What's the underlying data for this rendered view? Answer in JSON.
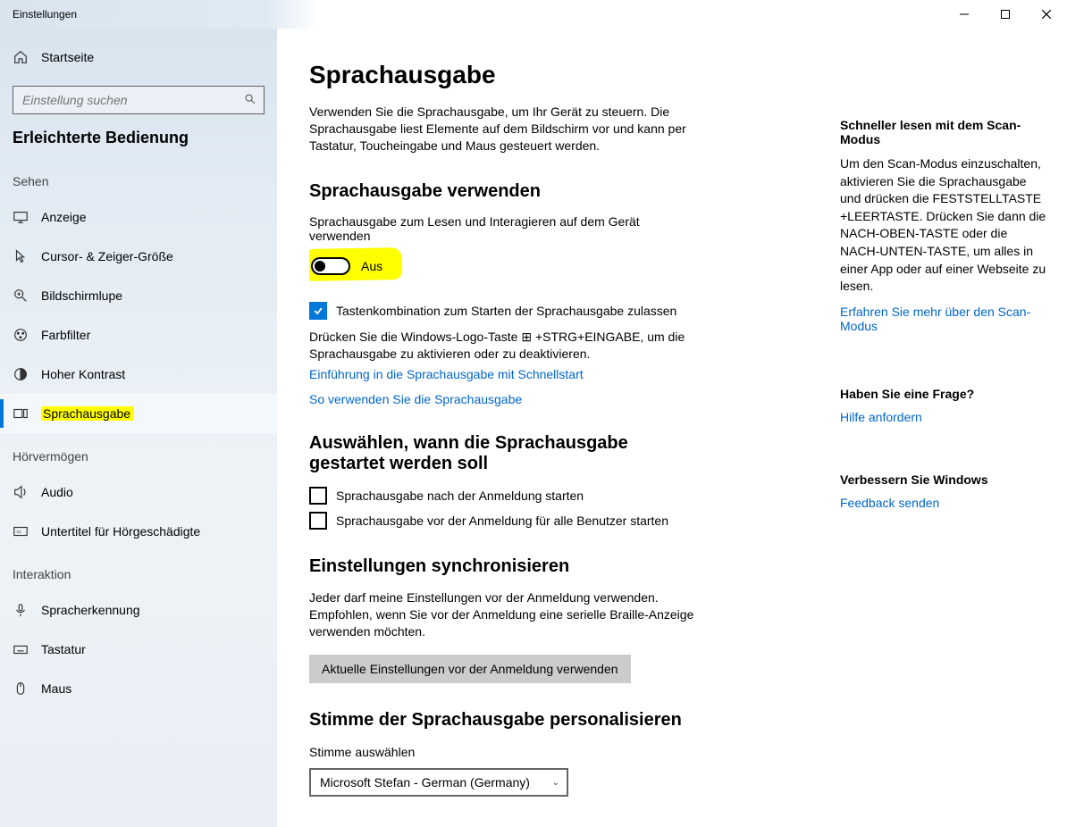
{
  "titlebar": {
    "title": "Einstellungen"
  },
  "sidebar": {
    "home": "Startseite",
    "search_placeholder": "Einstellung suchen",
    "section": "Erleichterte Bedienung",
    "groups": [
      {
        "label": "Sehen",
        "items": [
          {
            "name": "anzeige",
            "label": "Anzeige"
          },
          {
            "name": "cursor",
            "label": "Cursor- & Zeiger-Größe"
          },
          {
            "name": "bildschirmlupe",
            "label": "Bildschirmlupe"
          },
          {
            "name": "farbfilter",
            "label": "Farbfilter"
          },
          {
            "name": "kontrast",
            "label": "Hoher Kontrast"
          },
          {
            "name": "sprachausgabe",
            "label": "Sprachausgabe",
            "selected": true,
            "highlighted": true
          }
        ]
      },
      {
        "label": "Hörvermögen",
        "items": [
          {
            "name": "audio",
            "label": "Audio"
          },
          {
            "name": "untertitel",
            "label": "Untertitel für Hörgeschädigte"
          }
        ]
      },
      {
        "label": "Interaktion",
        "items": [
          {
            "name": "spracherkennung",
            "label": "Spracherkennung"
          },
          {
            "name": "tastatur",
            "label": "Tastatur"
          },
          {
            "name": "maus",
            "label": "Maus"
          }
        ]
      }
    ]
  },
  "main": {
    "title": "Sprachausgabe",
    "intro": "Verwenden Sie die Sprachausgabe, um Ihr Gerät zu steuern. Die Sprachausgabe liest Elemente auf dem Bildschirm vor und kann per Tastatur, Toucheingabe und Maus gesteuert werden.",
    "use": {
      "heading": "Sprachausgabe verwenden",
      "toggle_label": "Sprachausgabe zum Lesen und Interagieren auf dem Gerät verwenden",
      "toggle_state": "Aus",
      "check1_label": "Tastenkombination zum Starten der Sprachausgabe zulassen",
      "desc": "Drücken Sie die Windows-Logo-Taste ⊞ +STRG+EINGABE, um die Sprachausgabe zu aktivieren oder zu deaktivieren.",
      "link1": "Einführung in die Sprachausgabe mit Schnellstart",
      "link2": "So verwenden Sie die Sprachausgabe"
    },
    "when": {
      "heading": "Auswählen, wann die Sprachausgabe gestartet werden soll",
      "check1": "Sprachausgabe nach der Anmeldung starten",
      "check2": "Sprachausgabe vor der Anmeldung für alle Benutzer starten"
    },
    "sync": {
      "heading": "Einstellungen synchronisieren",
      "desc": "Jeder darf meine Einstellungen vor der Anmeldung verwenden. Empfohlen, wenn Sie vor der Anmeldung eine serielle Braille-Anzeige verwenden möchten.",
      "button": "Aktuelle Einstellungen vor der Anmeldung verwenden"
    },
    "voice": {
      "heading": "Stimme der Sprachausgabe personalisieren",
      "select_label": "Stimme auswählen",
      "select_value": "Microsoft Stefan - German (Germany)"
    }
  },
  "aside": {
    "scan_heading": "Schneller lesen mit dem Scan-Modus",
    "scan_body": "Um den Scan-Modus einzuschalten, aktivieren Sie die Sprachausgabe und drücken die FESTSTELLTASTE +LEERTASTE. Drücken Sie dann die NACH-OBEN-TASTE oder die NACH-UNTEN-TASTE, um alles in einer App oder auf einer Webseite zu lesen.",
    "scan_link": "Erfahren Sie mehr über den Scan-Modus",
    "question_heading": "Haben Sie eine Frage?",
    "question_link": "Hilfe anfordern",
    "improve_heading": "Verbessern Sie Windows",
    "improve_link": "Feedback senden"
  }
}
